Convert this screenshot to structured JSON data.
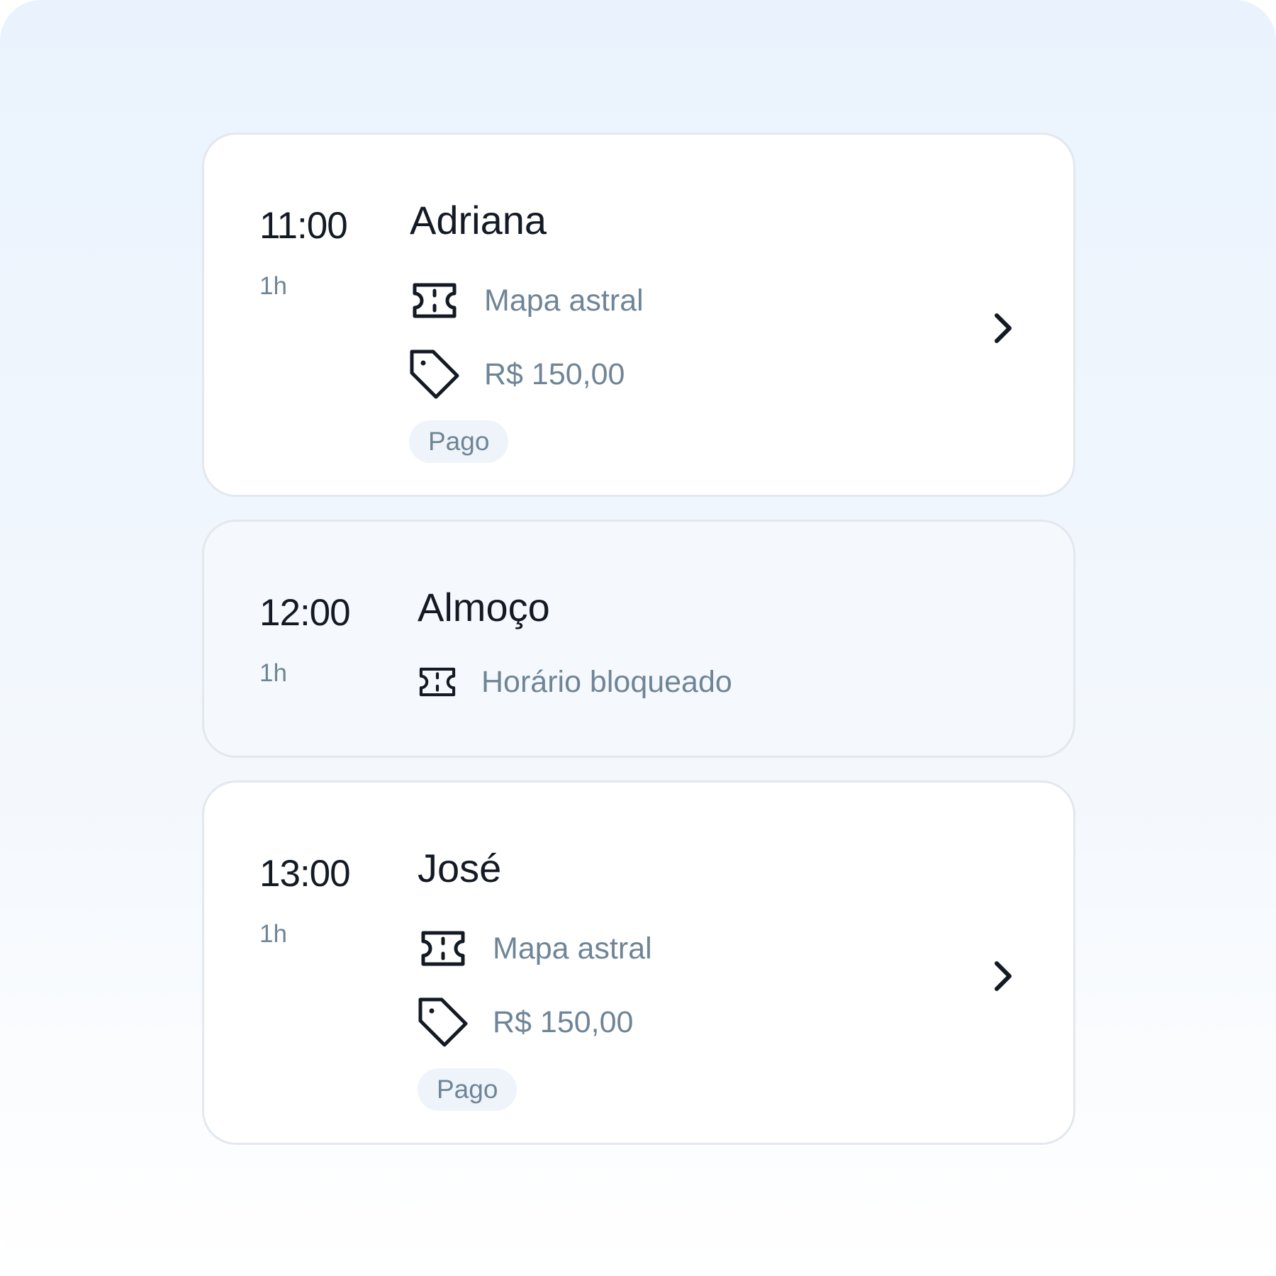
{
  "appointments": [
    {
      "time": "11:00",
      "duration": "1h",
      "name": "Adriana",
      "service": "Mapa astral",
      "price": "R$ 150,00",
      "status": "Pago"
    },
    {
      "time": "12:00",
      "duration": "1h",
      "name": "Almoço",
      "service": "Horário bloqueado"
    },
    {
      "time": "13:00",
      "duration": "1h",
      "name": "José",
      "service": "Mapa astral",
      "price": "R$ 150,00",
      "status": "Pago"
    }
  ],
  "icons": {
    "service": "ticket-icon",
    "price": "tag-icon",
    "open": "chevron-right-icon"
  },
  "colors": {
    "primary_text": "#141a24",
    "secondary_text": "#6f8597",
    "badge_background": "#eef4fa",
    "card_border": "#e3e8ef"
  }
}
